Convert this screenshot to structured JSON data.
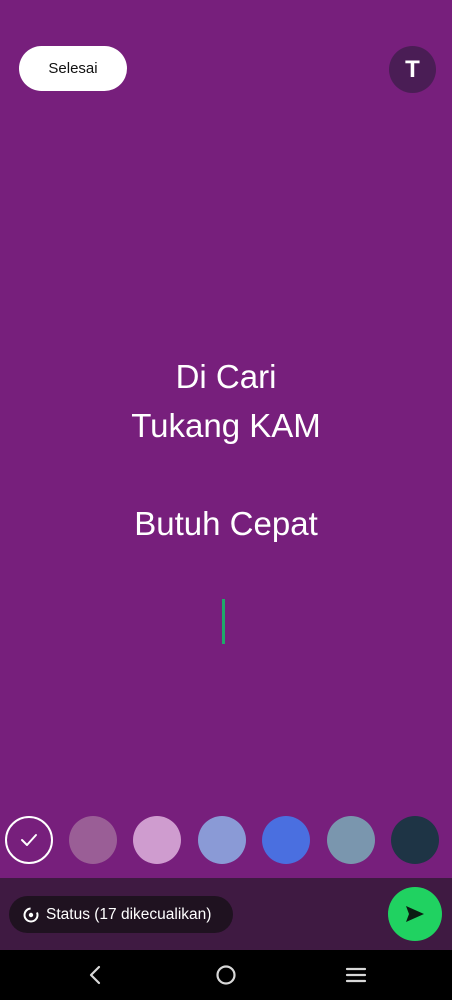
{
  "header": {
    "done_label": "Selesai",
    "font_button_label": "T"
  },
  "editor": {
    "text": "Di Cari\nTukang KAM\n\nButuh Cepat",
    "background_color": "#771f7c",
    "cursor_color": "#1fa96a"
  },
  "palette": {
    "swatches": [
      {
        "color": "#ffffff",
        "selected": true
      },
      {
        "color": "#9a5e96",
        "selected": false
      },
      {
        "color": "#cf9ccf",
        "selected": false
      },
      {
        "color": "#8a9ad6",
        "selected": false
      },
      {
        "color": "#4a6fe0",
        "selected": false
      },
      {
        "color": "#7a96ae",
        "selected": false
      },
      {
        "color": "#1e3445",
        "selected": false
      }
    ]
  },
  "footer": {
    "audience_label": "Status (17 dikecualikan)",
    "audience_icon": "status-privacy-icon",
    "send_icon": "send-icon",
    "send_color": "#20d261"
  },
  "navigation": {
    "back_icon": "back-icon",
    "home_icon": "home-icon",
    "recents_icon": "recents-icon"
  }
}
